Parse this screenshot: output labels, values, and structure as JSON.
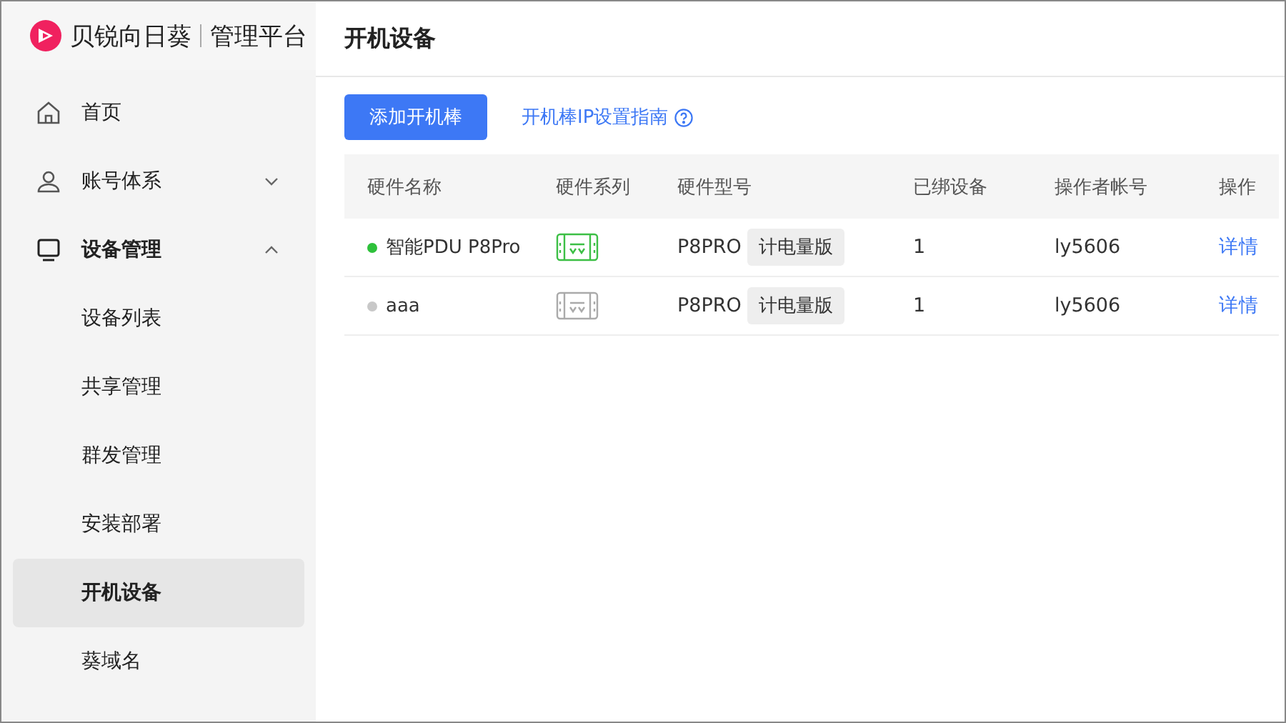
{
  "brand": {
    "name": "贝锐向日葵",
    "product": "管理平台"
  },
  "sidebar": {
    "items": [
      {
        "label": "首页",
        "selected": false
      },
      {
        "label": "账号体系",
        "expanded": false,
        "selected": false
      },
      {
        "label": "设备管理",
        "expanded": true,
        "selected": false,
        "children": [
          {
            "label": "设备列表",
            "selected": false
          },
          {
            "label": "共享管理",
            "selected": false
          },
          {
            "label": "群发管理",
            "selected": false
          },
          {
            "label": "安装部署",
            "selected": false
          },
          {
            "label": "开机设备",
            "selected": true
          },
          {
            "label": "葵域名",
            "selected": false
          }
        ]
      }
    ]
  },
  "page": {
    "title": "开机设备",
    "add_button": "添加开机棒",
    "guide_link": "开机棒IP设置指南"
  },
  "table": {
    "columns": [
      "硬件名称",
      "硬件系列",
      "硬件型号",
      "已绑设备",
      "操作者帐号",
      "操作"
    ],
    "rows": [
      {
        "name": "智能PDU P8Pro",
        "online": true,
        "model": "P8PRO",
        "edition": "计电量版",
        "bound": "1",
        "operator": "ly5606",
        "action": "详情"
      },
      {
        "name": "aaa",
        "online": false,
        "model": "P8PRO",
        "edition": "计电量版",
        "bound": "1",
        "operator": "ly5606",
        "action": "详情"
      }
    ]
  }
}
